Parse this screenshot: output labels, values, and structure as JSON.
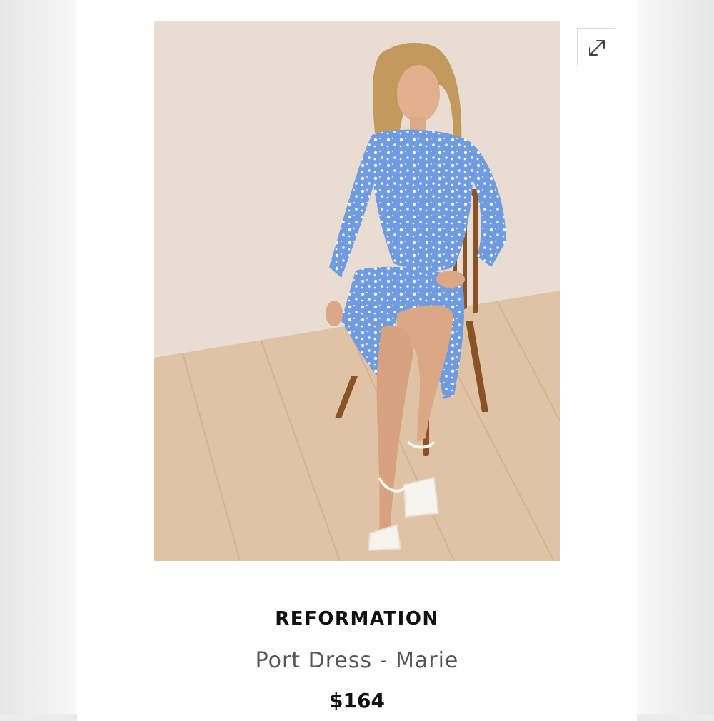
{
  "product": {
    "brand": "REFORMATION",
    "name": "Port Dress - Marie",
    "price": "$164"
  },
  "controls": {
    "expand_icon": "expand-arrows-icon"
  },
  "colors": {
    "dress": "#6f9be0",
    "wall": "#e9ddd3",
    "floor": "#e0c3a4",
    "chair": "#8a5326",
    "text_primary": "#111111",
    "text_secondary": "#555555"
  }
}
